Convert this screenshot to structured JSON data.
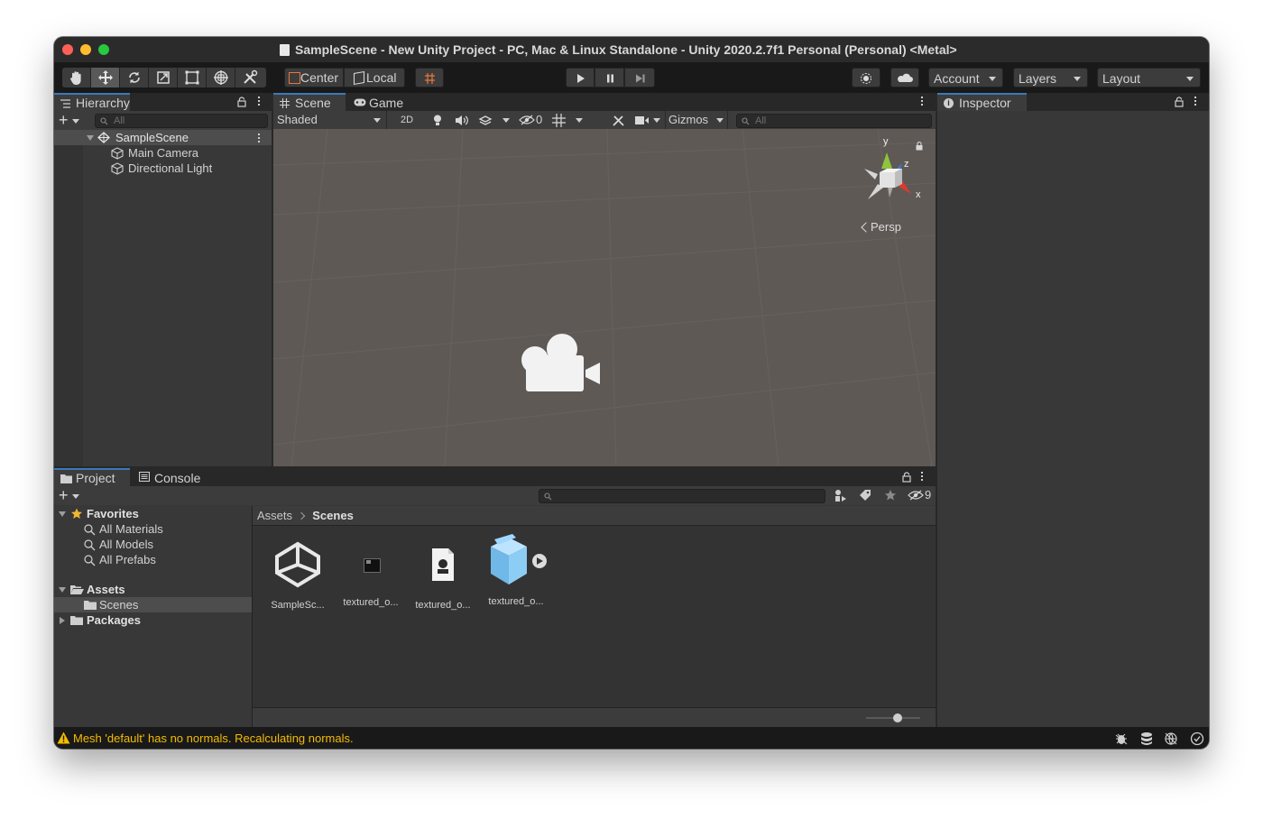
{
  "window": {
    "title": "SampleScene - New Unity Project - PC, Mac & Linux Standalone - Unity 2020.2.7f1 Personal (Personal) <Metal>"
  },
  "toolbar": {
    "tools": [
      "hand-tool-icon",
      "move-tool-icon",
      "rotate-tool-icon",
      "scale-tool-icon",
      "rect-tool-icon",
      "transform-tool-icon",
      "custom-tool-icon"
    ],
    "pivot_mode": "Center",
    "pivot_rotation": "Local",
    "account": "Account",
    "layers": "Layers",
    "layout": "Layout"
  },
  "hierarchy": {
    "tab_label": "Hierarchy",
    "search_placeholder": "All",
    "scene_name": "SampleScene",
    "objects": [
      "Main Camera",
      "Directional Light"
    ]
  },
  "scene": {
    "tab_scene": "Scene",
    "tab_game": "Game",
    "draw_mode": "Shaded",
    "mode_2d": "2D",
    "hidden_count": "0",
    "gizmos": "Gizmos",
    "search_placeholder": "All",
    "projection": "Persp",
    "axis_labels": {
      "x": "x",
      "y": "y",
      "z": "z"
    }
  },
  "inspector": {
    "tab_label": "Inspector"
  },
  "project": {
    "tab_project": "Project",
    "tab_console": "Console",
    "hidden_packages_count": "9",
    "favorites_label": "Favorites",
    "favorites": [
      "All Materials",
      "All Models",
      "All Prefabs"
    ],
    "assets_label": "Assets",
    "assets_children": [
      "Scenes"
    ],
    "packages_label": "Packages",
    "breadcrumb": [
      "Assets",
      "Scenes"
    ],
    "files": [
      {
        "name": "SampleSc...",
        "icon": "unity-scene-icon"
      },
      {
        "name": "textured_o...",
        "icon": "texture-thumbnail-icon"
      },
      {
        "name": "textured_o...",
        "icon": "material-file-icon"
      },
      {
        "name": "textured_o...",
        "icon": "model-prefab-icon"
      }
    ]
  },
  "status": {
    "message": "Mesh 'default' has no normals. Recalculating normals.",
    "warning_color": "#f4bc02"
  },
  "colors": {
    "accent": "#3a79bb",
    "selection": "#4d4d4d",
    "scene_background": "#5f5955"
  }
}
